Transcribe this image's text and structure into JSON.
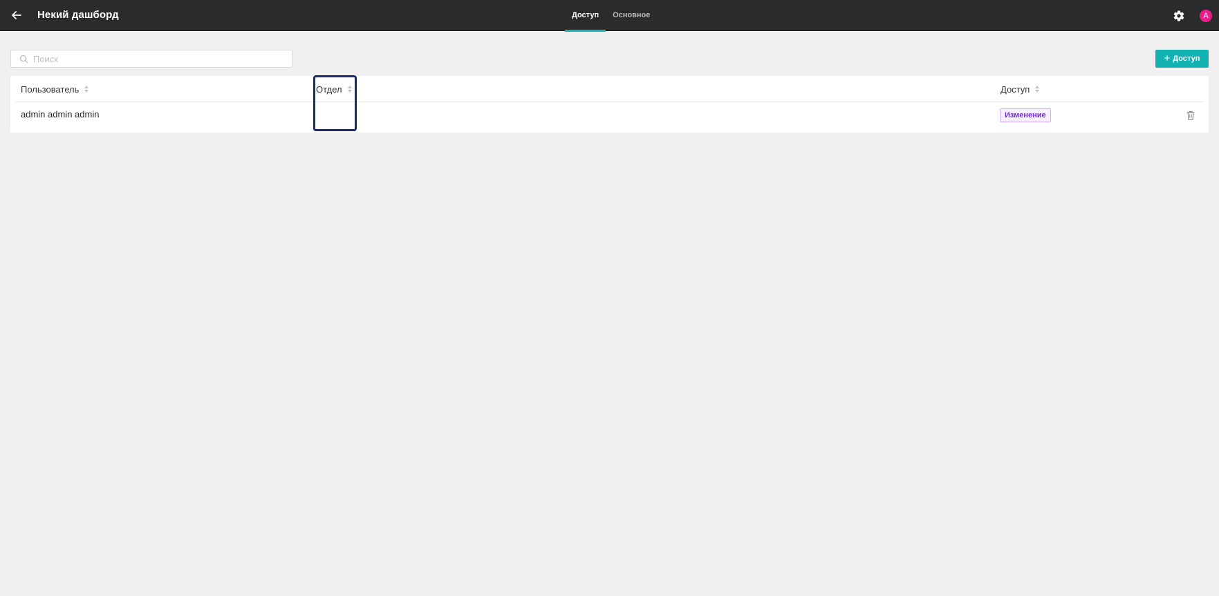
{
  "header": {
    "title": "Некий дашборд",
    "tabs": [
      {
        "label": "Доступ",
        "active": true
      },
      {
        "label": "Основное",
        "active": false
      }
    ],
    "avatar_letter": "A"
  },
  "toolbar": {
    "search_placeholder": "Поиск",
    "search_value": "",
    "add_label": "Доступ"
  },
  "table": {
    "columns": [
      {
        "label": "Пользователь"
      },
      {
        "label": "Отдел"
      },
      {
        "label": "Доступ"
      }
    ],
    "rows": [
      {
        "user": "admin admin admin",
        "department": "",
        "access": "Изменение"
      }
    ]
  },
  "colors": {
    "header_bg": "#2b2b2b",
    "accent": "#13b3b3",
    "avatar": "#e91e8c",
    "tag_text": "#722ed1",
    "tag_bg": "#f9f0ff",
    "tag_border": "#d3adf7",
    "highlight": "#17296e"
  }
}
